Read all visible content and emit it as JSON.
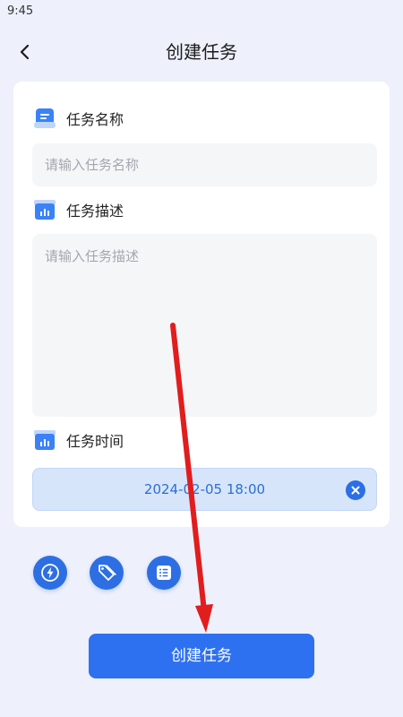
{
  "status_bar": {
    "time": "9:45"
  },
  "header": {
    "title": "创建任务"
  },
  "form": {
    "name_label": "任务名称",
    "name_placeholder": "请输入任务名称",
    "desc_label": "任务描述",
    "desc_placeholder": "请输入任务描述",
    "time_label": "任务时间",
    "time_value": "2024-02-05 18:00"
  },
  "toolbar": {
    "icons": [
      "lightning-icon",
      "tag-icon",
      "list-icon"
    ]
  },
  "submit": {
    "label": "创建任务"
  },
  "colors": {
    "accent": "#2e71f0",
    "background": "#eef1fb",
    "annotation_arrow": "#e11d1d"
  }
}
